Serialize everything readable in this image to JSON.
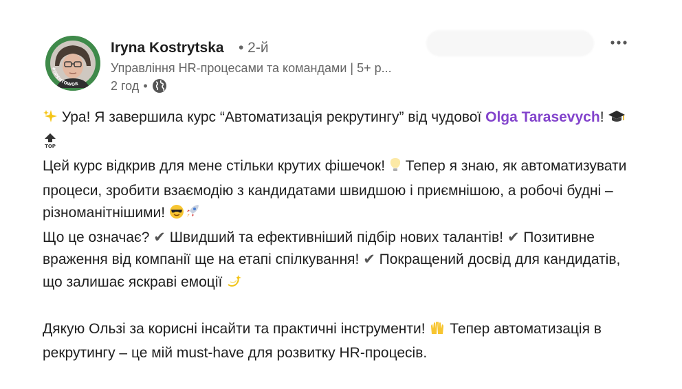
{
  "author": {
    "name": "Iryna Kostrytska",
    "degree": "• 2-й",
    "headline": "Управління HR-процесами та командами | 5+ р...",
    "time": "2 год",
    "separator": "•",
    "avatar_badge": "#OPENTOWORK"
  },
  "icons": {
    "globe": "globe-icon",
    "more": "more-options-icon",
    "sparkles": "sparkles-emoji",
    "cap": "graduation-cap-emoji",
    "top": "top-arrow-emoji",
    "bulb": "light-bulb-emoji",
    "sunglasses": "sunglasses-face-emoji",
    "rocket": "rocket-emoji",
    "check": "heavy-check-mark",
    "dizzy": "dizzy-emoji",
    "hands": "raising-hands-emoji"
  },
  "post": {
    "p1_a": " Ура! Я завершила курс “Автоматизація рекрутингу” від чудової ",
    "mention": "Olga Tarasevych",
    "p1_b": "!",
    "p2_a": "Цей курс відкрив для мене стільки крутих фішечок!",
    "p2_b": " Тепер я знаю, як автоматизувати процеси, зробити взаємодію з кандидатами швидшою і приємнішою, а робочі будні – різноманітнішими!",
    "p3_a": "Що це означає?",
    "p3_b": " Швидший та ефективніший підбір нових талантів!",
    "p3_c": " Позитивне враження від компанії ще на етапі спілкування!",
    "p3_d": " Покращений досвід для кандидатів, що залишає яскраві емоції",
    "p4_a": "Дякую Ользі за корисні інсайти та практичні інструменти!",
    "p4_b": " Тепер автоматизація в рекрутингу – це мій must-have для розвитку HR-процесів."
  },
  "colors": {
    "mention": "#8344cc",
    "secondary_text": "#666666",
    "primary_text": "#1f1f1f",
    "avatar_frame": "#3f8a4a"
  }
}
